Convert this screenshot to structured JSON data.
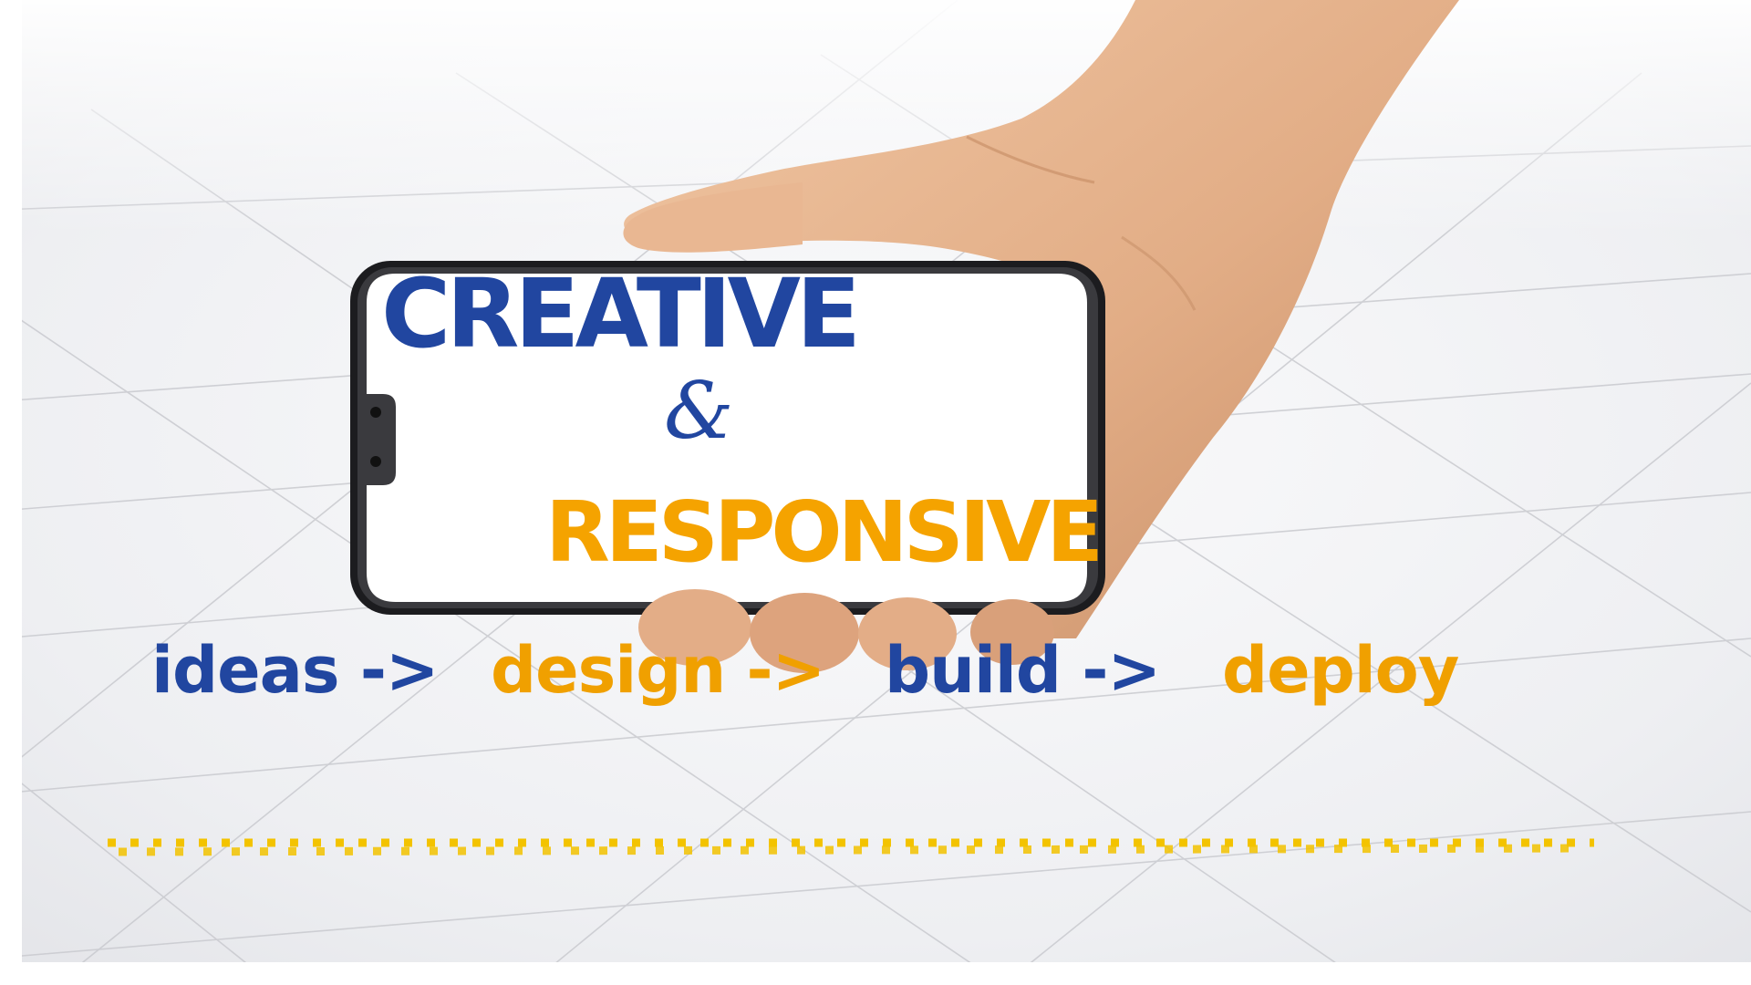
{
  "colors": {
    "blue": "#2146a0",
    "orange": "#f5a300",
    "dots": "#f3c300",
    "phone_frame": "#1c1c1f",
    "floor": "#f1f2f4",
    "skin": "#e8b893"
  },
  "headline": {
    "line1": "CREATIVE",
    "ampersand": "&",
    "line2": "RESPONSIVE"
  },
  "steps": [
    {
      "label": "ideas ->",
      "color": "#2146a0"
    },
    {
      "label": "design ->",
      "color": "#f0a000"
    },
    {
      "label": "build ->",
      "color": "#2146a0"
    },
    {
      "label": "deploy",
      "color": "#f0a000"
    }
  ],
  "decorations": {
    "dotted_line": "yellow-dotted-divider",
    "phone": "smartphone-held-in-hand"
  }
}
